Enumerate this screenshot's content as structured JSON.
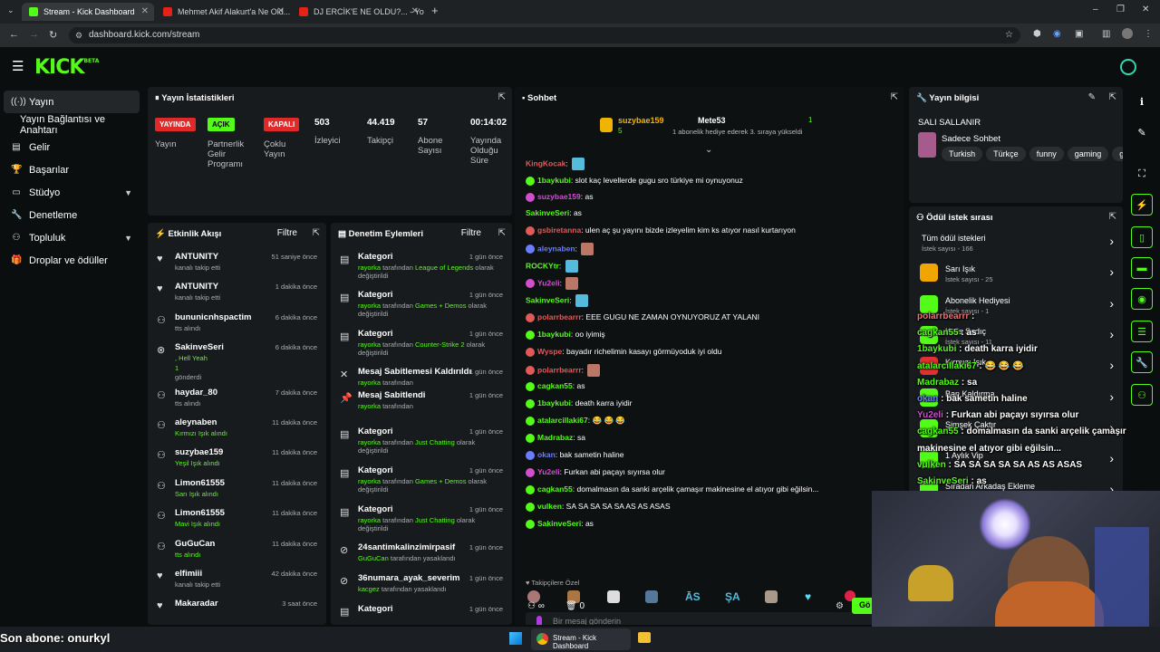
{
  "browser": {
    "tabs": [
      {
        "title": "Stream - Kick Dashboard",
        "active": true
      },
      {
        "title": "Mehmet Akif Alakurt'a Ne Old...",
        "active": false
      },
      {
        "title": "DJ ERCİK'E NE OLDU?... - YouTube",
        "active": false
      }
    ],
    "url": "dashboard.kick.com/stream"
  },
  "brand": {
    "logo": "KICK",
    "beta": "BETA",
    "accent": "#53fc18"
  },
  "sidebar": {
    "items": [
      {
        "label": "Yayın",
        "icon": "stream-icon"
      },
      {
        "label": "Yayın Bağlantısı ve Anahtarı",
        "icon": ""
      },
      {
        "label": "Gelir",
        "icon": "chart-icon"
      },
      {
        "label": "Başarılar",
        "icon": "trophy-icon"
      },
      {
        "label": "Stüdyo",
        "icon": "monitor-icon"
      },
      {
        "label": "Denetleme",
        "icon": "wrench-icon"
      },
      {
        "label": "Topluluk",
        "icon": "community-icon"
      },
      {
        "label": "Droplar ve ödüller",
        "icon": "gift-icon"
      }
    ]
  },
  "stats": {
    "title": "Yayın İstatistikleri",
    "items": [
      {
        "badge": "YAYINDA",
        "label": "Yayın"
      },
      {
        "badge": "AÇIK",
        "label": "Partnerlik Gelir Programı"
      },
      {
        "badge": "KAPALI",
        "label": "Çoklu Yayın"
      },
      {
        "value": "503",
        "label": "İzleyici"
      },
      {
        "value": "44.419",
        "label": "Takipçi"
      },
      {
        "value": "57",
        "label": "Abone Sayısı"
      },
      {
        "value": "00:14:02",
        "label": "Yayında Olduğu Süre"
      }
    ]
  },
  "activity": {
    "title": "Etkinlik Akışı",
    "filter": "Filtre",
    "items": [
      {
        "name": "ANTUNITY",
        "sub": "kanalı takip etti",
        "time": "51 saniye önce"
      },
      {
        "name": "ANTUNITY",
        "sub": "kanalı takip etti",
        "time": "1 dakika önce"
      },
      {
        "name": "bununicnhspactim",
        "sub": "tts alındı",
        "time": "6 dakika önce"
      },
      {
        "name": "SakinveSeri",
        "sub": ", Hell Yeah",
        "time": "6 dakika önce",
        "extra": "1",
        "extra2": "gönderdi"
      },
      {
        "name": "haydar_80",
        "sub": "tts alındı",
        "time": "7 dakika önce"
      },
      {
        "name": "aleynaben",
        "sub": "Kırmızı Işık alındı",
        "time": "11 dakika önce"
      },
      {
        "name": "suzybae159",
        "sub": "Yeşil Işık alındı",
        "time": "11 dakika önce"
      },
      {
        "name": "Limon61555",
        "sub": "Sarı Işık alındı",
        "time": "11 dakika önce"
      },
      {
        "name": "Limon61555",
        "sub": "Mavi Işık alındı",
        "time": "11 dakika önce"
      },
      {
        "name": "GuGuCan",
        "sub": "tts alındı",
        "time": "11 dakika önce"
      },
      {
        "name": "elfimiii",
        "sub": "kanalı takip etti",
        "time": "42 dakika önce"
      },
      {
        "name": "Makaradar",
        "sub": "",
        "time": "3 saat önce"
      }
    ]
  },
  "moderation": {
    "title": "Denetim Eylemleri",
    "filter": "Filtre",
    "items": [
      {
        "title": "Kategori",
        "who": "rayorka",
        "mid": " tarafından ",
        "what": "League of Legends",
        "end": " olarak değiştirildi",
        "time": "1 gün önce"
      },
      {
        "title": "Kategori",
        "who": "rayorka",
        "mid": " tarafından ",
        "what": "Games + Demos",
        "end": " olarak değiştirildi",
        "time": "1 gün önce"
      },
      {
        "title": "Kategori",
        "who": "rayorka",
        "mid": " tarafından ",
        "what": "Counter-Strike 2",
        "end": " olarak değiştirildi",
        "time": "1 gün önce"
      },
      {
        "title": "Mesaj Sabitlemesi Kaldırıldı",
        "who": "rayorka",
        "mid": " tarafından",
        "what": "",
        "end": "",
        "time": "1 gün önce"
      },
      {
        "title": "Mesaj Sabitlendi",
        "who": "rayorka",
        "mid": " tarafından",
        "what": "",
        "end": "",
        "time": "1 gün önce"
      },
      {
        "title": "Kategori",
        "who": "rayorka",
        "mid": " tarafından ",
        "what": "Just Chatting",
        "end": " olarak değiştirildi",
        "time": "1 gün önce"
      },
      {
        "title": "Kategori",
        "who": "rayorka",
        "mid": " tarafından ",
        "what": "Games + Demos",
        "end": " olarak değiştirildi",
        "time": "1 gün önce"
      },
      {
        "title": "Kategori",
        "who": "rayorka",
        "mid": " tarafından ",
        "what": "Just Chatting",
        "end": " olarak değiştirildi",
        "time": "1 gün önce"
      },
      {
        "title": "24santimkalinzimirpasif",
        "who": "GuGuCan",
        "mid": " tarafından yasaklandı",
        "what": "",
        "end": "",
        "time": "1 gün önce"
      },
      {
        "title": "36numara_ayak_severim",
        "who": "kacgez",
        "mid": " tarafından yasaklandı",
        "what": "",
        "end": "",
        "time": "1 gün önce"
      },
      {
        "title": "Kategori",
        "who": "",
        "mid": "",
        "what": "",
        "end": "",
        "time": "1 gün önce"
      }
    ]
  },
  "chat": {
    "title": "Sohbet",
    "pinned": {
      "user": "suzybae159",
      "count": "5",
      "gifter": "Mete53",
      "gifter_count": "1",
      "note": "1 abonelik hediye ederek 3. sıraya yükseldi"
    },
    "messages": [
      {
        "user": "KingKocak",
        "color": "#e05a5a",
        "text": ""
      },
      {
        "user": "1baykubi",
        "color": "#53fc18",
        "text": "slot kaç levellerde gugu sro türkiye mi oynuyonuz"
      },
      {
        "user": "suzybae159",
        "color": "#d04fd0",
        "text": "as"
      },
      {
        "user": "SakinveSeri",
        "color": "#53fc18",
        "text": "as"
      },
      {
        "user": "gsbiretanna",
        "color": "#e05a5a",
        "text": "ulen aç şu yayını bizde izleyelim kim ks atıyor nasıl kurtarıyon"
      },
      {
        "user": "aleynaben",
        "color": "#6a7dff",
        "text": ""
      },
      {
        "user": "ROCKYtr",
        "color": "#53fc18",
        "text": ""
      },
      {
        "user": "Yu2eli",
        "color": "#d04fd0",
        "text": ""
      },
      {
        "user": "SakinveSeri",
        "color": "#53fc18",
        "text": ""
      },
      {
        "user": "polarrbearrr",
        "color": "#e05a5a",
        "text": "EEE GUGU NE ZAMAN OYNUYORUZ AT YALANI"
      },
      {
        "user": "1baykubi",
        "color": "#53fc18",
        "text": "oo iyimiş"
      },
      {
        "user": "Wyspe",
        "color": "#e05a5a",
        "text": "bayadır richelimin kasayı görmüyoduk iyi oldu"
      },
      {
        "user": "polarrbearrr",
        "color": "#e05a5a",
        "text": ""
      },
      {
        "user": "cagkan55",
        "color": "#53fc18",
        "text": "as"
      },
      {
        "user": "1baykubi",
        "color": "#53fc18",
        "text": "death karra iyidir"
      },
      {
        "user": "atalarcillaki67",
        "color": "#53fc18",
        "text": "😂 😂 😂"
      },
      {
        "user": "Madrabaz",
        "color": "#53fc18",
        "text": "sa"
      },
      {
        "user": "okan",
        "color": "#6a7dff",
        "text": "bak sametin haline"
      },
      {
        "user": "Yu2eli",
        "color": "#d04fd0",
        "text": "Furkan abi paçayı sıyırsa olur"
      },
      {
        "user": "cagkan55",
        "color": "#53fc18",
        "text": "domalmasın da sanki arçelik çamaşır makinesine el atıyor gibi eğilsin..."
      },
      {
        "user": "vulken",
        "color": "#53fc18",
        "text": "SA SA SA SA SA AS AS ASAS"
      },
      {
        "user": "SakinveSeri",
        "color": "#53fc18",
        "text": "as"
      }
    ],
    "followers_only": "Takipçilere Özel",
    "input_placeholder": "Bir mesaj gönderin",
    "counter": "0",
    "send": "Gö"
  },
  "streaminfo": {
    "title": "Yayın bilgisi",
    "stream_title": "SALI SALLANIR",
    "category": "Sadece Sohbet",
    "tags": [
      "Turkish",
      "Türkçe",
      "funny",
      "gaming",
      "gu"
    ]
  },
  "rewards": {
    "title": "Ödül istek sırası",
    "items": [
      {
        "name": "Tüm ödül istekleri",
        "sub": "İstek sayısı - 166",
        "color": ""
      },
      {
        "name": "Sarı Işık",
        "sub": "İstek sayısı - 25",
        "color": "#f0a500"
      },
      {
        "name": "Abonelik Hediyesi",
        "sub": "İstek sayısı - 1",
        "color": "#53fc18"
      },
      {
        "name": "Kolis Sadıç",
        "sub": "İstek sayısı - 11",
        "color": "#53fc18"
      },
      {
        "name": "Kırmızı Işık",
        "sub": "",
        "color": "#e03030"
      },
      {
        "name": "Ban Kaldırma",
        "sub": "",
        "color": "#53fc18"
      },
      {
        "name": "Şimşek Çaktır",
        "sub": "",
        "color": "#53fc18"
      },
      {
        "name": "1 Aylık Vip",
        "sub": "",
        "color": "#53fc18"
      },
      {
        "name": "Sıradan Arkadaş Ekleme",
        "sub": "",
        "color": "#53fc18"
      }
    ]
  },
  "overlay": {
    "lines": [
      {
        "user": "polarrbearrr",
        "text": ":",
        "color": "#ff6b6b"
      },
      {
        "user": "cagkan55",
        "text": ": as",
        "color": "#53fc18"
      },
      {
        "user": "1baykubi",
        "text": ": death karra iyidir",
        "color": "#53fc18"
      },
      {
        "user": "atalarcillaki67",
        "text": ": 😂 😂 😂",
        "color": "#53fc18"
      },
      {
        "user": "Madrabaz",
        "text": ": sa",
        "color": "#53fc18"
      },
      {
        "user": "okan",
        "text": ": bak sametin haline",
        "color": "#6a7dff"
      },
      {
        "user": "Yu2eli",
        "text": ": Furkan abi paçayı sıyırsa olur",
        "color": "#d04fd0"
      },
      {
        "user": "cagkan55",
        "text": ": domalmasın da sanki arçelik çamaşır",
        "color": "#53fc18"
      },
      {
        "user": "",
        "text": "makinesine el atıyor gibi eğilsin...",
        "color": "#53fc18"
      },
      {
        "user": "vulken",
        "text": ": SA SA SA SA SA AS AS ASAS",
        "color": "#53fc18"
      },
      {
        "user": "SakinveSeri",
        "text": ": as",
        "color": "#53fc18"
      }
    ],
    "last_sub": "Son abone: onurkyl"
  },
  "taskbar": {
    "app": "Stream - Kick Dashboard"
  }
}
